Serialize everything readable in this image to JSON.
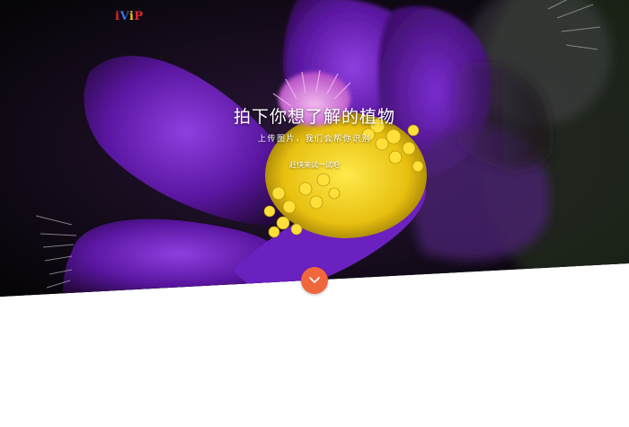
{
  "logo": {
    "part1": "i",
    "part2": "V",
    "part3": "i",
    "part4": "P"
  },
  "hero": {
    "title": "拍下你想了解的植物",
    "subtitle": "上传图片，我们会帮你识别",
    "cta_label": "赶快来试一试吧",
    "image_description_icon": "purple-pasque-flower-photo"
  },
  "scroll_button": {
    "icon": "chevron-down-icon"
  },
  "colors": {
    "accent": "#f0673d",
    "hero_text": "#ffffff",
    "petal": "#6a1fb0",
    "stamen": "#f2d21a"
  }
}
